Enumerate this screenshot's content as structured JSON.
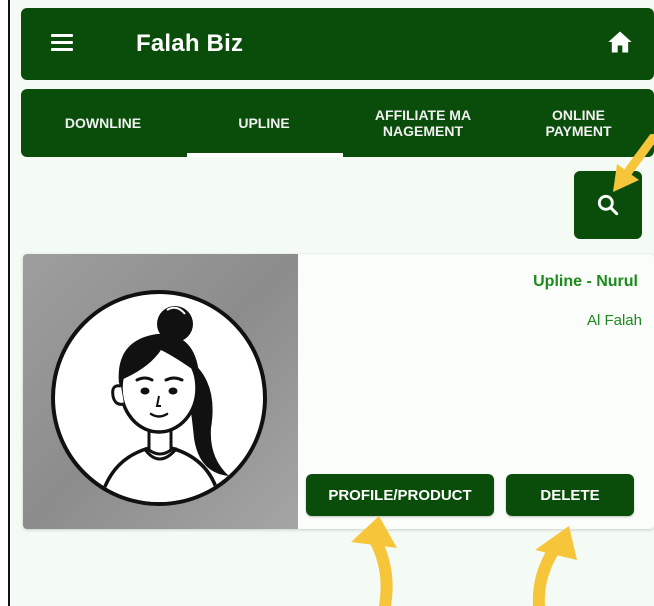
{
  "app": {
    "title": "Falah Biz",
    "icons": {
      "menu": "hamburger-menu-icon",
      "home": "home-icon",
      "search": "search-icon"
    }
  },
  "tabs": [
    {
      "label": "DOWNLINE",
      "active": false
    },
    {
      "label": "UPLINE",
      "active": true
    },
    {
      "label": "AFFILIATE MA\nNAGEMENT",
      "active": false
    },
    {
      "label": "ONLINE\nPAYMENT",
      "active": false
    }
  ],
  "card": {
    "name": "Upline - Nurul",
    "company": "Al Falah",
    "profile_button": "PROFILE/PRODUCT",
    "delete_button": "DELETE"
  },
  "colors": {
    "primary": "#0a4d0a",
    "accent_text": "#1c8a1c",
    "background": "#f4fbf4",
    "annotation_arrow": "#f7c53a"
  }
}
